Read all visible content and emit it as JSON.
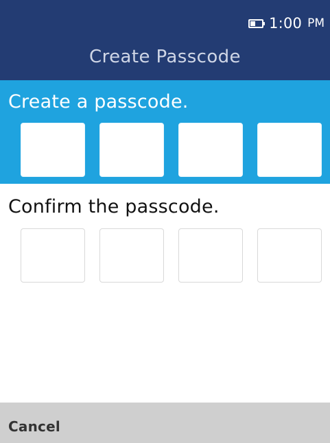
{
  "status_bar": {
    "time": "1:00",
    "ampm": "PM",
    "battery_icon": "battery-icon"
  },
  "header": {
    "title": "Create Passcode"
  },
  "create": {
    "label": "Create a passcode."
  },
  "confirm": {
    "label": "Confirm the passcode."
  },
  "softkeys": {
    "cancel_label": "Cancel"
  },
  "colors": {
    "header_bg": "#233c73",
    "accent_blue": "#1fa3df",
    "softkey_bg": "#cfcfcf"
  }
}
